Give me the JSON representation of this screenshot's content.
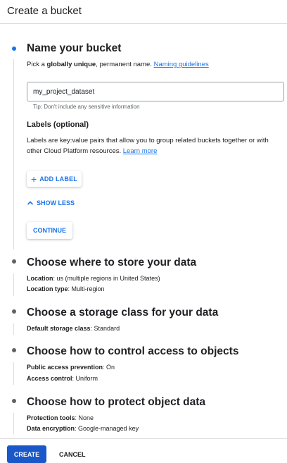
{
  "header": {
    "title": "Create a bucket"
  },
  "steps": {
    "name": {
      "title": "Name your bucket",
      "desc_pre": "Pick a ",
      "desc_bold": "globally unique",
      "desc_post": ", permanent name. ",
      "desc_link": "Naming guidelines",
      "input_value": "my_project_dataset",
      "tip": "Tip: Don't include any sensitive information",
      "labels_title": "Labels (optional)",
      "labels_desc": "Labels are key:value pairs that allow you to group related buckets together or with other Cloud Platform resources.",
      "labels_link": "Learn more",
      "add_label": "ADD LABEL",
      "show_less": "SHOW LESS",
      "continue": "CONTINUE"
    },
    "location": {
      "title": "Choose where to store your data",
      "location_key": "Location",
      "location_value": ": us (multiple regions in United States)",
      "type_key": "Location type",
      "type_value": ": Multi-region"
    },
    "storage": {
      "title": "Choose a storage class for your data",
      "class_key": "Default storage class",
      "class_value": ": Standard"
    },
    "access": {
      "title": "Choose how to control access to objects",
      "prevention_key": "Public access prevention",
      "prevention_value": ": On",
      "control_key": "Access control",
      "control_value": ": Uniform"
    },
    "protect": {
      "title": "Choose how to protect object data",
      "tools_key": "Protection tools",
      "tools_value": ": None",
      "encryption_key": "Data encryption",
      "encryption_value": ": Google-managed key"
    }
  },
  "footer": {
    "create": "CREATE",
    "cancel": "CANCEL"
  },
  "colors": {
    "accent": "#1a73e8",
    "primary_button": "#1a57c8"
  }
}
